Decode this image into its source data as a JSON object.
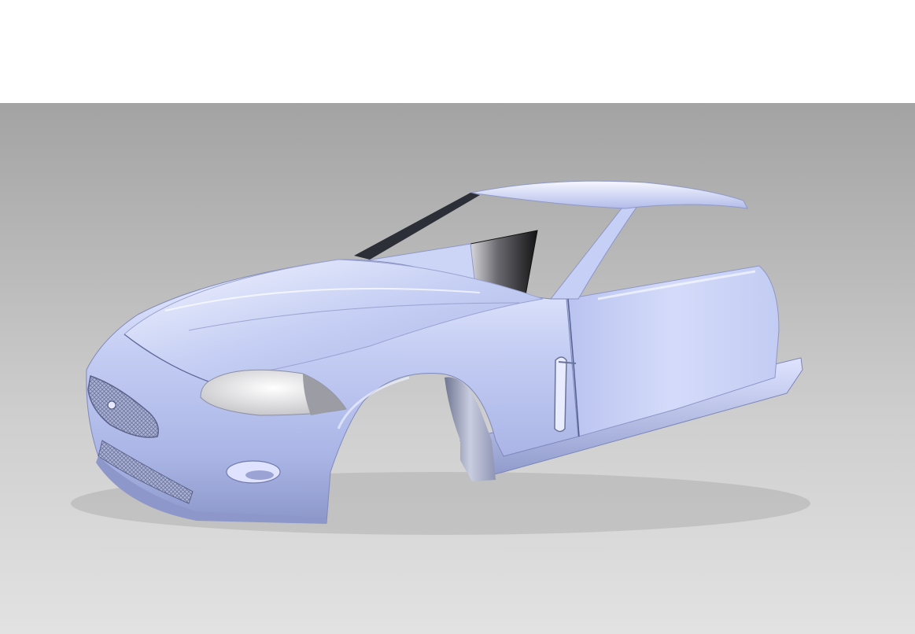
{
  "scene": {
    "subject": "car-body-model",
    "colors": {
      "background_top": "#ffffff",
      "floor_top": "#a3a3a3",
      "floor_bottom": "#e2e2e2",
      "body_paint": "#b8c2ee",
      "body_highlight": "#eef1ff",
      "body_shadow": "#7f89b8",
      "glass_dark": "#1c1c1f",
      "interior_grey": "#8d8d93"
    }
  }
}
